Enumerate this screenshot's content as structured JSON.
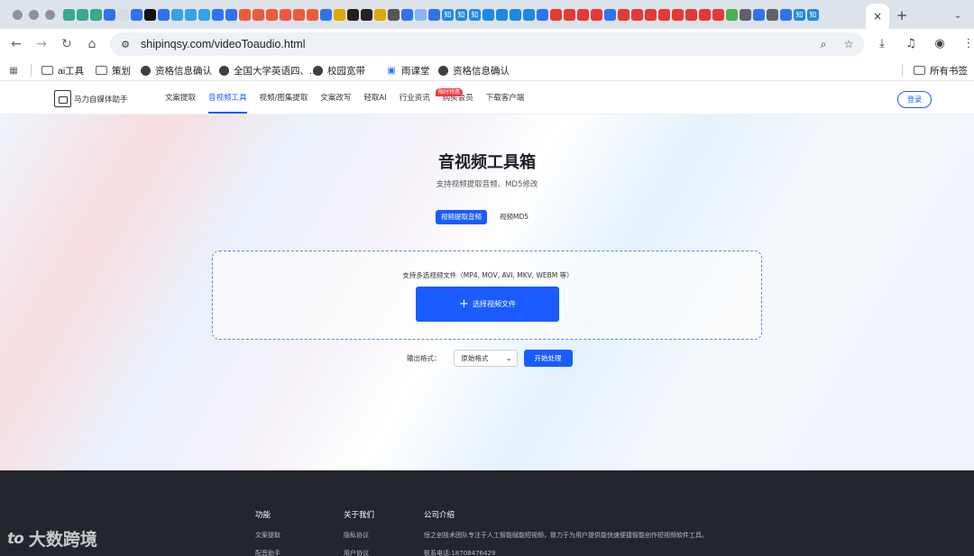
{
  "browser": {
    "tab_close": "×",
    "new_tab": "+",
    "tab_dropdown": "⌄",
    "url": "shipinqsy.com/videoToaudio.html",
    "pinned_tabs": [
      {
        "color": "#3aa88c",
        "label": ""
      },
      {
        "color": "#3aa88c",
        "label": ""
      },
      {
        "color": "#3aa88c",
        "label": ""
      },
      {
        "color": "#3073f0",
        "label": ""
      },
      {
        "color": "#d8dbe0",
        "label": ""
      },
      {
        "color": "#3073f0",
        "label": ""
      },
      {
        "color": "#111111",
        "label": ""
      },
      {
        "color": "#3073f0",
        "label": ""
      },
      {
        "color": "#36a3e6",
        "label": ""
      },
      {
        "color": "#36a3e6",
        "label": ""
      },
      {
        "color": "#36a3e6",
        "label": ""
      },
      {
        "color": "#3073f0",
        "label": ""
      },
      {
        "color": "#3073f0",
        "label": ""
      },
      {
        "color": "#ef5b3a",
        "label": ""
      },
      {
        "color": "#ef5b3a",
        "label": ""
      },
      {
        "color": "#ef5b3a",
        "label": ""
      },
      {
        "color": "#ef5b3a",
        "label": ""
      },
      {
        "color": "#ef5b3a",
        "label": ""
      },
      {
        "color": "#ef5b3a",
        "label": ""
      },
      {
        "color": "#3073f0",
        "label": ""
      },
      {
        "color": "#e0a800",
        "label": ""
      },
      {
        "color": "#222222",
        "label": ""
      },
      {
        "color": "#222222",
        "label": ""
      },
      {
        "color": "#e0a800",
        "label": ""
      },
      {
        "color": "#555555",
        "label": ""
      },
      {
        "color": "#3073f0",
        "label": ""
      },
      {
        "color": "#8ab4f8",
        "label": ""
      },
      {
        "color": "#3073f0",
        "label": ""
      },
      {
        "color": "#1e88e5",
        "label": "知"
      },
      {
        "color": "#1e88e5",
        "label": "知"
      },
      {
        "color": "#1e88e5",
        "label": "知"
      },
      {
        "color": "#1e88e5",
        "label": ""
      },
      {
        "color": "#1e88e5",
        "label": ""
      },
      {
        "color": "#1e88e5",
        "label": ""
      },
      {
        "color": "#1e88e5",
        "label": ""
      },
      {
        "color": "#3073f0",
        "label": ""
      },
      {
        "color": "#e53935",
        "label": ""
      },
      {
        "color": "#e53935",
        "label": ""
      },
      {
        "color": "#e53935",
        "label": ""
      },
      {
        "color": "#e53935",
        "label": ""
      },
      {
        "color": "#3073f0",
        "label": ""
      },
      {
        "color": "#e53935",
        "label": ""
      },
      {
        "color": "#e53935",
        "label": ""
      },
      {
        "color": "#e53935",
        "label": ""
      },
      {
        "color": "#e53935",
        "label": ""
      },
      {
        "color": "#e53935",
        "label": ""
      },
      {
        "color": "#e53935",
        "label": ""
      },
      {
        "color": "#e53935",
        "label": ""
      },
      {
        "color": "#e53935",
        "label": ""
      },
      {
        "color": "#4caf50",
        "label": ""
      },
      {
        "color": "#5f6368",
        "label": ""
      },
      {
        "color": "#3073f0",
        "label": ""
      },
      {
        "color": "#5f6368",
        "label": ""
      },
      {
        "color": "#3073f0",
        "label": ""
      },
      {
        "color": "#1e88e5",
        "label": "知"
      },
      {
        "color": "#1e88e5",
        "label": "知"
      }
    ]
  },
  "bookmarks": [
    {
      "label": "ai工具",
      "icon": "folder"
    },
    {
      "label": "策划",
      "icon": "folder"
    },
    {
      "label": "资格信息确认",
      "icon": "globe"
    },
    {
      "label": "全国大学英语四、...",
      "icon": "globe"
    },
    {
      "label": "校园宽带",
      "icon": "globe"
    },
    {
      "label": "雨课堂",
      "icon": "app"
    },
    {
      "label": "资格信息确认",
      "icon": "globe"
    }
  ],
  "bookmarks_all": "所有书签",
  "site": {
    "logo_text": "马力自媒体助手",
    "nav": [
      "文案提取",
      "音视频工具",
      "视频/图集提取",
      "文案改写",
      "轻取AI",
      "行业资讯",
      "购买会员",
      "下载客户端"
    ],
    "active_nav": 1,
    "hot_badge": "限时特惠",
    "login": "登录"
  },
  "hero": {
    "title": "音视频工具箱",
    "subtitle": "支持视频提取音频、MD5修改",
    "tabs": [
      "视频提取音频",
      "视频MD5"
    ],
    "active_tab": 0,
    "drop_hint": "支持多选视频文件（MP4, MOV, AVI, MKV, WEBM 等）",
    "choose_button": "选择视频文件",
    "output_label": "输出格式：",
    "format_value": "原始格式",
    "start_button": "开始处理"
  },
  "footer": {
    "col1_title": "功能",
    "col1_items": [
      "文案提取",
      "配音助手"
    ],
    "col2_title": "关于我们",
    "col2_items": [
      "隐私协议",
      "用户协议"
    ],
    "col3_title": "公司介绍",
    "col3_text": "恒之创技术团队专注于人工智能赋能短视频，致力于为用户提供能快速便捷智能创作短视频软件工具。",
    "col3_phone": "联系电话:18708476429"
  },
  "watermark": {
    "mark": "to",
    "text": "大数跨境"
  }
}
